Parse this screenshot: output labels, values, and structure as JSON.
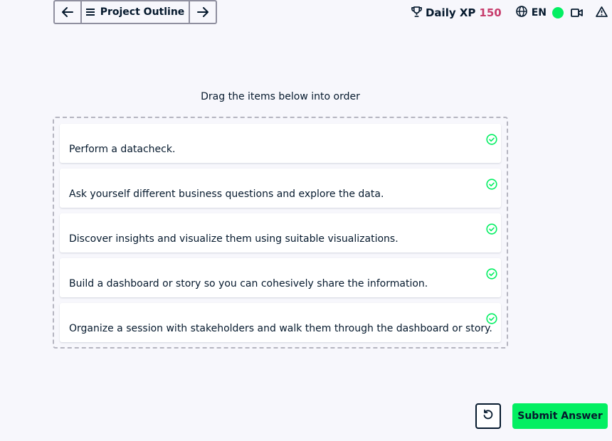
{
  "nav": {
    "back_icon": "arrow-left-icon",
    "outline_icon": "hamburger-icon",
    "outline_label": "Project Outline",
    "forward_icon": "arrow-right-icon"
  },
  "header": {
    "xp_icon": "trophy-icon",
    "xp_label": "Daily XP",
    "xp_value": "150",
    "language_icon": "globe-icon",
    "language": "EN",
    "status_color": "#03ef62",
    "video_icon": "video-camera-icon",
    "alert_icon": "warning-triangle-icon"
  },
  "exercise": {
    "prompt": "Drag the items below into order",
    "items": [
      {
        "text": "Perform a datacheck.",
        "status_icon": "check-circle-icon"
      },
      {
        "text": "Ask yourself different business questions and explore the data.",
        "status_icon": "check-circle-icon"
      },
      {
        "text": "Discover insights and visualize them using suitable visualizations.",
        "status_icon": "check-circle-icon"
      },
      {
        "text": "Build a dashboard or story so you can cohesively share the information.",
        "status_icon": "check-circle-icon"
      },
      {
        "text": "Organize a session with stakeholders and walk them through the dashboard or story.",
        "status_icon": "check-circle-icon"
      }
    ]
  },
  "footer": {
    "reset_icon": "undo-icon",
    "submit_label": "Submit Answer"
  },
  "colors": {
    "accent": "#03ef62",
    "xp_value": "#c73c6c",
    "text": "#05192d",
    "background": "#f7f7fc"
  }
}
